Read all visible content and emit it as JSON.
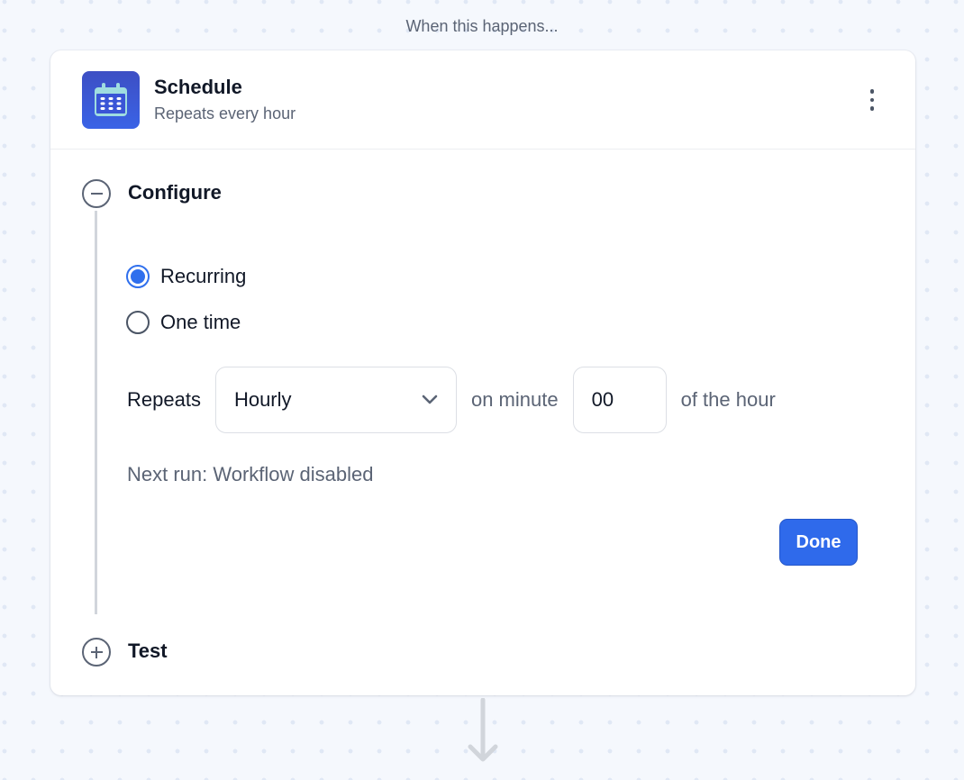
{
  "canvas": {
    "trigger_label": "When this happens..."
  },
  "card": {
    "icon": "calendar-icon",
    "title": "Schedule",
    "subtitle": "Repeats every hour",
    "menu_icon": "more-vertical-icon"
  },
  "steps": {
    "configure": {
      "label": "Configure",
      "state": "expanded",
      "icon": "minus-circle-icon"
    },
    "test": {
      "label": "Test",
      "state": "collapsed",
      "icon": "plus-circle-icon"
    }
  },
  "schedule_type": {
    "options": [
      {
        "label": "Recurring",
        "checked": true
      },
      {
        "label": "One time",
        "checked": false
      }
    ]
  },
  "repeat": {
    "label": "Repeats",
    "frequency": "Hourly",
    "on_minute_label": "on minute",
    "minute_value": "00",
    "suffix_label": "of the hour"
  },
  "next_run": "Next run: Workflow disabled",
  "done_button": "Done",
  "colors": {
    "accent": "#2f6aeb",
    "icon_bg": "#3a55d6",
    "icon_fg": "#9fdde0",
    "canvas_bg": "#f5f8fd",
    "muted_text": "#5b6475"
  },
  "connector": "arrow-down-icon"
}
